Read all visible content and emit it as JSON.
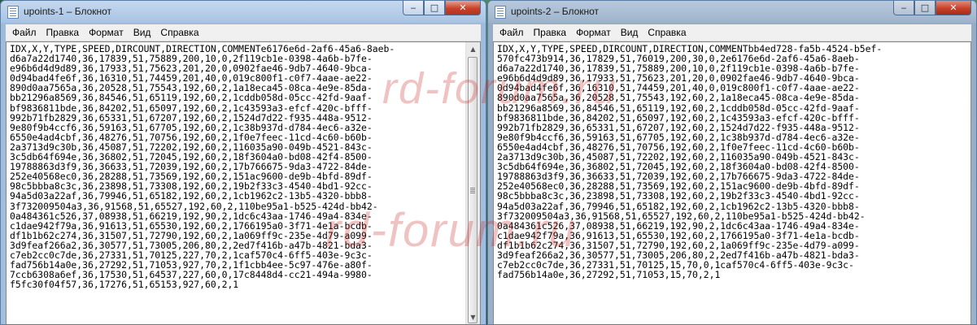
{
  "windows": [
    {
      "title": "upoints-1 – Блокнот",
      "menu": [
        "Файл",
        "Правка",
        "Формат",
        "Вид",
        "Справка"
      ],
      "controls": [
        "minimize",
        "maximize",
        "close"
      ],
      "lines": [
        "IDX,X,Y,TYPE,SPEED,DIRCOUNT,DIRECTION,COMMENTe6176e6d-2af6-45a6-8aeb-",
        "d6a7a22d1740,36,17839,51,75889,200,10,0,2f119cb1e-0398-4a6b-b7fe-",
        "e96b6d4d9d89,36,17933,51,75623,201,20,0,0902fae46-9db7-4640-9bca-",
        "0d94bad4fe6f,36,16310,51,74459,201,40,0,019c800f1-c0f7-4aae-ae22-",
        "890d0aa7565a,36,20528,51,75543,192,60,2,1a18eca45-08ca-4e9e-85da-",
        "bb21296a8569,36,84546,51,65119,192,60,2,1cddb058d-05cc-42fd-9aaf-",
        "bf9836811bde,36,84202,51,65097,192,60,2,1c43593a3-efcf-420c-bfff-",
        "992b71fb2829,36,65331,51,67207,192,60,2,1524d7d22-f935-448a-9512-",
        "9e80f9b4ccf6,36,59163,51,67705,192,60,2,1c38b937d-d784-4ec6-a32e-",
        "6550e4ad4cbf,36,48276,51,70756,192,60,2,1f0e7feec-11cd-4c60-b60b-",
        "2a3713d9c30b,36,45087,51,72202,192,60,2,116035a90-049b-4521-843c-",
        "3c5db64f694e,36,36802,51,72045,192,60,2,18f3604a0-bd08-42f4-8500-",
        "19788863d3f9,36,36633,51,72039,192,60,2,17b766675-9da3-4722-84de-",
        "252e40568ec0,36,28288,51,73569,192,60,2,151ac9600-de9b-4bfd-89df-",
        "98c5bbba8c3c,36,23898,51,73308,192,60,2,19b2f33c3-4540-4bd1-92cc-",
        "94a5d03a22af,36,79946,51,65182,192,60,2,1cb1962c2-13b5-4320-bbb8-",
        "3f732009504a3,36,91568,51,65527,192,60,2,110be95a1-b525-424d-bb42-",
        "0a484361c526,37,08938,51,66219,192,90,2,1dc6c43aa-1746-49a4-834e-",
        "c1dae942f79a,36,91613,51,65530,192,60,2,1766195a0-3f71-4e1a-bcdb-",
        "df1b1b62c274,36,31507,51,72790,192,60,2,1a069ff9c-235e-4d79-a099-",
        "3d9feaf266a2,36,30577,51,73005,206,80,2,2ed7f416b-a47b-4821-bda3-",
        "c7eb2cc0c7de,36,27331,51,70125,227,70,2,1caf570c4-6ff5-403e-9c3c-",
        "fad756b14a0e,36,27292,51,71053,927,70,2,1f1cbb4ee-5c97-476e-a80f-",
        "7ccb6308a6ef,36,17530,51,64537,227,60,0,17c8448d4-cc21-494a-9980-",
        "f5fc30f04f57,36,17276,51,65153,927,60,2,1"
      ]
    },
    {
      "title": "upoints-2 – Блокнот",
      "menu": [
        "Файл",
        "Правка",
        "Формат",
        "Вид",
        "Справка"
      ],
      "controls": [
        "minimize",
        "maximize",
        "close"
      ],
      "lines": [
        "IDX,X,Y,TYPE,SPEED,DIRCOUNT,DIRECTION,COMMENTbb4ed728-fa5b-4524-b5ef-",
        "570fc473b914,36,17829,51,76019,200,30,0,2e6176e6d-2af6-45a6-8aeb-",
        "d6a7a22d1740,36,17839,51,75889,200,10,0,2f119cb1e-0398-4a6b-b7fe-",
        "e96b6d4d9d89,36,17933,51,75623,201,20,0,0902fae46-9db7-4640-9bca-",
        "0d94bad4fe6f,36,16310,51,74459,201,40,0,019c800f1-c0f7-4aae-ae22-",
        "890d0aa7565a,36,20528,51,75543,192,60,2,1a18eca45-08ca-4e9e-85da-",
        "bb21296a8569,36,84546,51,65119,192,60,2,1cddb058d-05cc-42fd-9aaf-",
        "bf9836811bde,36,84202,51,65097,192,60,2,1c43593a3-efcf-420c-bfff-",
        "992b71fb2829,36,65331,51,67207,192,60,2,1524d7d22-f935-448a-9512-",
        "9e80f9b4ccf6,36,59163,51,67705,192,60,2,1c38b937d-d784-4ec6-a32e-",
        "6550e4ad4cbf,36,48276,51,70756,192,60,2,1f0e7feec-11cd-4c60-b60b-",
        "2a3713d9c30b,36,45087,51,72202,192,60,2,116035a90-049b-4521-843c-",
        "3c5db64f694e,36,36802,51,72045,192,60,2,18f3604a0-bd08-42f4-8500-",
        "19788863d3f9,36,36633,51,72039,192,60,2,17b766675-9da3-4722-84de-",
        "252e40568ec0,36,28288,51,73569,192,60,2,151ac9600-de9b-4bfd-89df-",
        "98c5bbba8c3c,36,23898,51,73308,192,60,2,19b2f33c3-4540-4bd1-92cc-",
        "94a5d03a22af,36,79946,51,65182,192,60,2,1cb1962c2-13b5-4320-bbb8-",
        "3f732009504a3,36,91568,51,65527,192,60,2,110be95a1-b525-424d-bb42-",
        "0a484361c526,37,08938,51,66219,192,90,2,1dc6c43aa-1746-49a4-834e-",
        "c1dae942f79a,36,91613,51,65530,192,60,2,1766195a0-3f71-4e1a-bcdb-",
        "df1b1b62c274,36,31507,51,72790,192,60,2,1a069ff9c-235e-4d79-a099-",
        "3d9feaf266a2,36,30577,51,73005,206,80,2,2ed7f416b-a47b-4821-bda3-",
        "c7eb2cc0c7de,36,27331,51,70125,15,70,0,1caf570c4-6ff5-403e-9c3c-",
        "fad756b14a0e,36,27292,51,71053,15,70,2,1"
      ]
    }
  ],
  "watermark": "rd-forum.ru",
  "colors": {
    "watermark": "#c82828",
    "close_button": "#c8412a",
    "editor_background": "#ffffff"
  }
}
